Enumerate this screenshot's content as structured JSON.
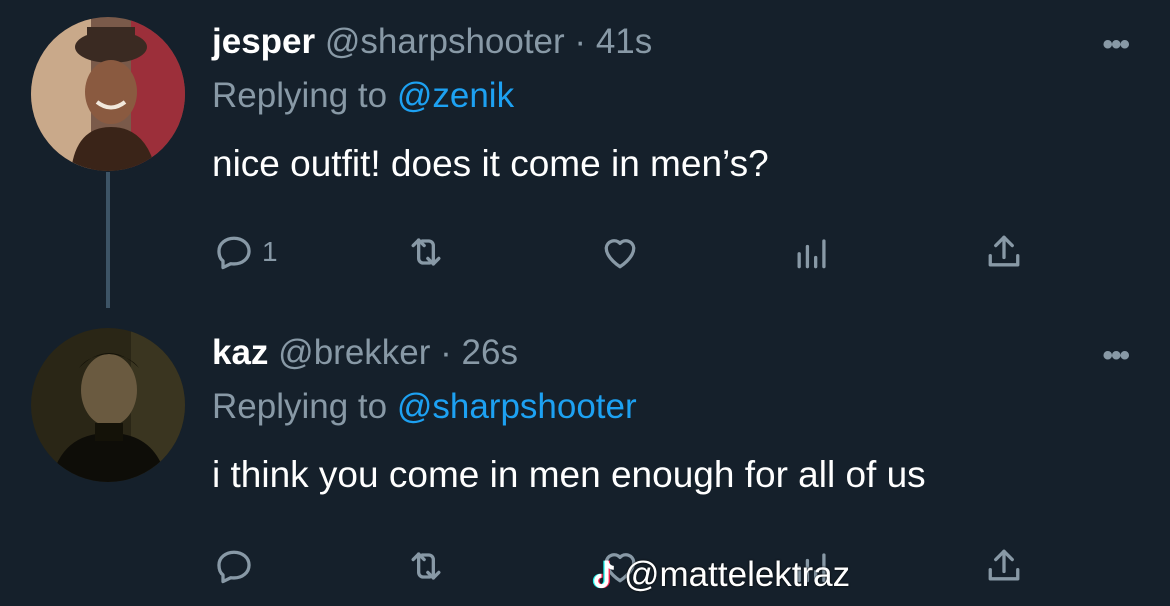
{
  "tweets": [
    {
      "name": "jesper",
      "handle": "@sharpshooter",
      "dot": "·",
      "time": "41s",
      "replying_prefix": "Replying to ",
      "replying_to": "@zenik",
      "text": "nice outfit! does it come in men’s?",
      "reply_count": "1"
    },
    {
      "name": "kaz",
      "handle": "@brekker",
      "dot": "·",
      "time": "26s",
      "replying_prefix": "Replying to ",
      "replying_to": "@sharpshooter",
      "text": "i think you come in men enough for all of us",
      "reply_count": ""
    }
  ],
  "more_label": "•••",
  "watermark": "@mattelektraz",
  "colors": {
    "background": "#15202b",
    "secondary_text": "#8899a6",
    "link": "#1da1f2",
    "thread_line": "#3d5466"
  },
  "icons": [
    "reply-icon",
    "retweet-icon",
    "like-icon",
    "analytics-icon",
    "share-icon",
    "tiktok-icon"
  ]
}
